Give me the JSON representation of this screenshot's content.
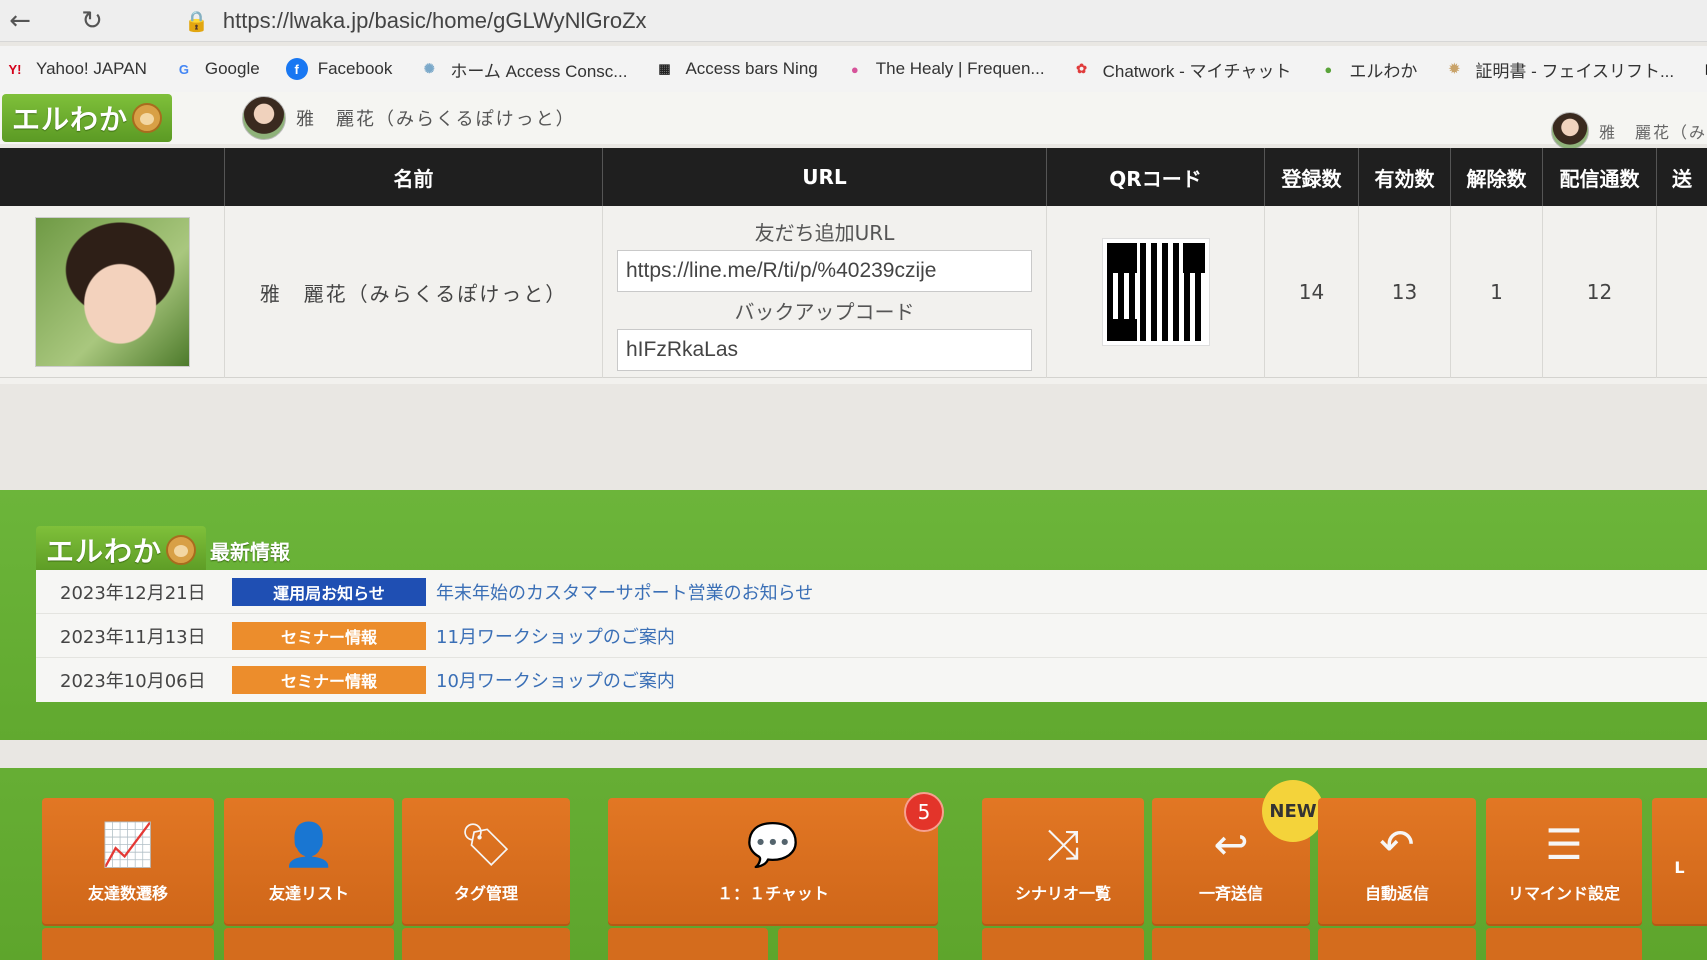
{
  "browser": {
    "url": "https://lwaka.jp/basic/home/gGLWyNlGroZx",
    "bookmarks": [
      {
        "label": "Yahoo! JAPAN",
        "icon": "Y!",
        "color": "#d4001a"
      },
      {
        "label": "Google",
        "icon": "G",
        "color": "#4285f4"
      },
      {
        "label": "Facebook",
        "icon": "f",
        "color": "#1877f2"
      },
      {
        "label": "ホーム Access Consc...",
        "icon": "✺",
        "color": "#7aa8c9"
      },
      {
        "label": "Access bars Ning",
        "icon": "▦",
        "color": "#222222"
      },
      {
        "label": "The Healy | Frequen...",
        "icon": "●",
        "color": "#d6539a"
      },
      {
        "label": "Chatwork - マイチャット",
        "icon": "✿",
        "color": "#e03b3b"
      },
      {
        "label": "エルわか",
        "icon": "●",
        "color": "#5aa33a"
      },
      {
        "label": "証明書 - フェイスリフト...",
        "icon": "✹",
        "color": "#c9a36a"
      },
      {
        "label": "ホー",
        "icon": "▦",
        "color": "#222222"
      }
    ]
  },
  "header": {
    "logo": "エルわか",
    "user_name": "雅　麗花（みらくるぽけっと）",
    "user_right": "雅　麗花（み"
  },
  "account_table": {
    "columns": [
      "",
      "名前",
      "URL",
      "QRコード",
      "登録数",
      "有効数",
      "解除数",
      "配信通数",
      "送"
    ],
    "row": {
      "name": "雅　麗花（みらくるぽけっと）",
      "friend_url_label": "友だち追加URL",
      "friend_url": "https://line.me/R/ti/p/%40239czije",
      "backup_label": "バックアップコード",
      "backup_code": "hIFzRkaLas",
      "registered": "14",
      "active": "13",
      "cancelled": "1",
      "delivered": "12"
    }
  },
  "news": {
    "logo": "エルわか",
    "section_label": "最新情報",
    "items": [
      {
        "date": "2023年12月21日",
        "tag": "運用局お知らせ",
        "tag_color": "#1f4fb3",
        "title": "年末年始のカスタマーサポート営業のお知らせ"
      },
      {
        "date": "2023年11月13日",
        "tag": "セミナー情報",
        "tag_color": "#ec8d2c",
        "title": "11月ワークショップのご案内"
      },
      {
        "date": "2023年10月06日",
        "tag": "セミナー情報",
        "tag_color": "#ec8d2c",
        "title": "10月ワークショップのご案内"
      }
    ]
  },
  "menu": {
    "tiles": [
      {
        "label": "友達数遷移",
        "icon": "chart-line-icon"
      },
      {
        "label": "友達リスト",
        "icon": "user-icon"
      },
      {
        "label": "タグ管理",
        "icon": "tag-icon"
      },
      {
        "label": "１：１チャット",
        "icon": "chat-icon",
        "badge": "5"
      },
      {
        "label": "シナリオ一覧",
        "icon": "shuffle-icon"
      },
      {
        "label": "一斉送信",
        "icon": "reply-icon",
        "badge": "NEW"
      },
      {
        "label": "自動返信",
        "icon": "undo-icon"
      },
      {
        "label": "リマインド設定",
        "icon": "list-icon"
      },
      {
        "label": "L",
        "icon": ""
      }
    ]
  }
}
